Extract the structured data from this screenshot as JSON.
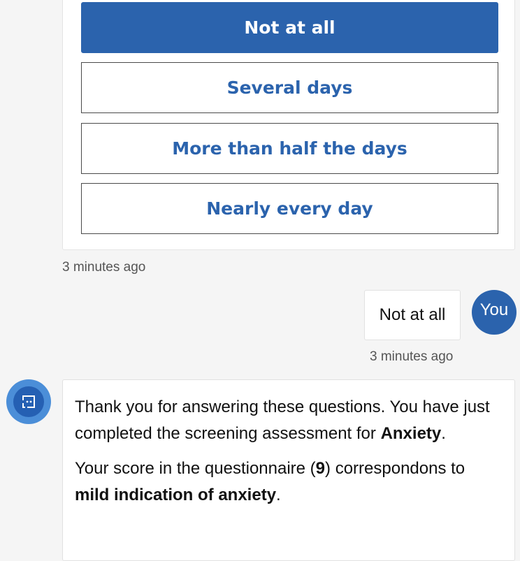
{
  "options": [
    {
      "label": "Not at all",
      "selected": true
    },
    {
      "label": "Several days",
      "selected": false
    },
    {
      "label": "More than half the days",
      "selected": false
    },
    {
      "label": "Nearly every day",
      "selected": false
    }
  ],
  "options_timestamp": "3 minutes ago",
  "user_reply": {
    "text": "Not at all",
    "avatar_label": "You",
    "timestamp": "3 minutes ago"
  },
  "bot": {
    "avatar_icon": "chat-bot-icon",
    "para1_before": "Thank you for answering these questions. You have just completed the screening assessment for ",
    "para1_bold": "Anxiety",
    "para1_after": ".",
    "para2_before": "Your score in the questionnaire (",
    "para2_score": "9",
    "para2_middle": ") correspondons to ",
    "para2_bold": "mild indication of anxiety",
    "para2_after": "."
  },
  "colors": {
    "accent": "#2b63ad",
    "bot_avatar_outer": "#4b8ed8",
    "background": "#f5f5f5"
  }
}
